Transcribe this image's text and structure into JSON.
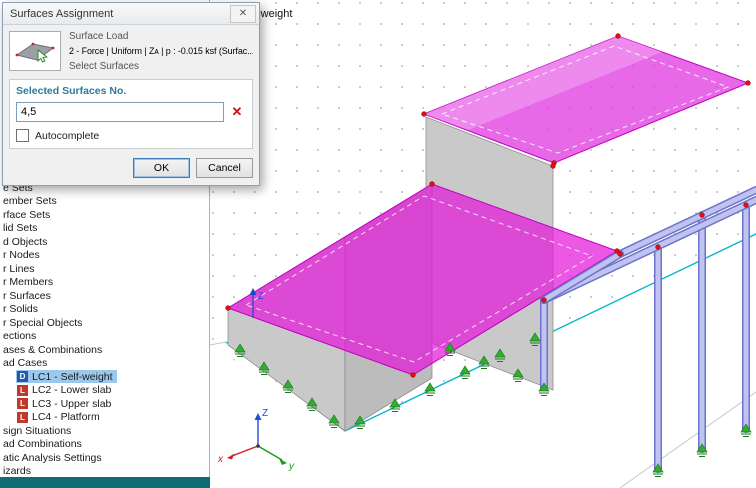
{
  "dialog": {
    "title": "Surfaces Assignment",
    "surface_load": {
      "label": "Surface Load",
      "value": "2 - Force | Uniform | Zᴀ | p : -0.015 ksf (Surfac...",
      "action": "Select Surfaces"
    },
    "selected_surfaces": {
      "header": "Selected Surfaces No.",
      "value": "4,5",
      "autocomplete_label": "Autocomplete",
      "autocomplete_checked": false
    },
    "buttons": {
      "ok": "OK",
      "cancel": "Cancel"
    },
    "icons": {
      "close": "✕",
      "clear": "✕"
    }
  },
  "sidebar": {
    "items": [
      {
        "label": "e Sets"
      },
      {
        "label": "ember Sets"
      },
      {
        "label": "rface Sets"
      },
      {
        "label": "lid Sets"
      },
      {
        "label": "d Objects"
      },
      {
        "label": "r Nodes"
      },
      {
        "label": "r Lines"
      },
      {
        "label": "r Members"
      },
      {
        "label": "r Surfaces"
      },
      {
        "label": "r Solids"
      },
      {
        "label": "r Special Objects"
      },
      {
        "label": "ections"
      },
      {
        "label": "ases & Combinations"
      },
      {
        "label": "ad Cases"
      },
      {
        "label": "LC1 - Self-weight",
        "badge": "D",
        "selected": true
      },
      {
        "label": "LC2 - Lower slab",
        "badge": "L",
        "selected": false
      },
      {
        "label": "LC3 - Upper slab",
        "badge": "L",
        "selected": false
      },
      {
        "label": "LC4 - Platform",
        "badge": "L",
        "selected": false
      },
      {
        "label": "sign Situations"
      },
      {
        "label": "ad Combinations"
      },
      {
        "label": "atic Analysis Settings"
      },
      {
        "label": "izards"
      }
    ],
    "status_bar_color": "#0e6c74"
  },
  "viewport": {
    "load_case_label": "-weight",
    "axes": {
      "x": "x",
      "y": "y",
      "z": "Z"
    },
    "colors": {
      "surface_load_magenta": "#e318d8",
      "member_blue": "#6e72cc",
      "support_green": "#2fae2f",
      "node_red": "#e01010",
      "base_line_cyan": "#00b8c8"
    }
  }
}
